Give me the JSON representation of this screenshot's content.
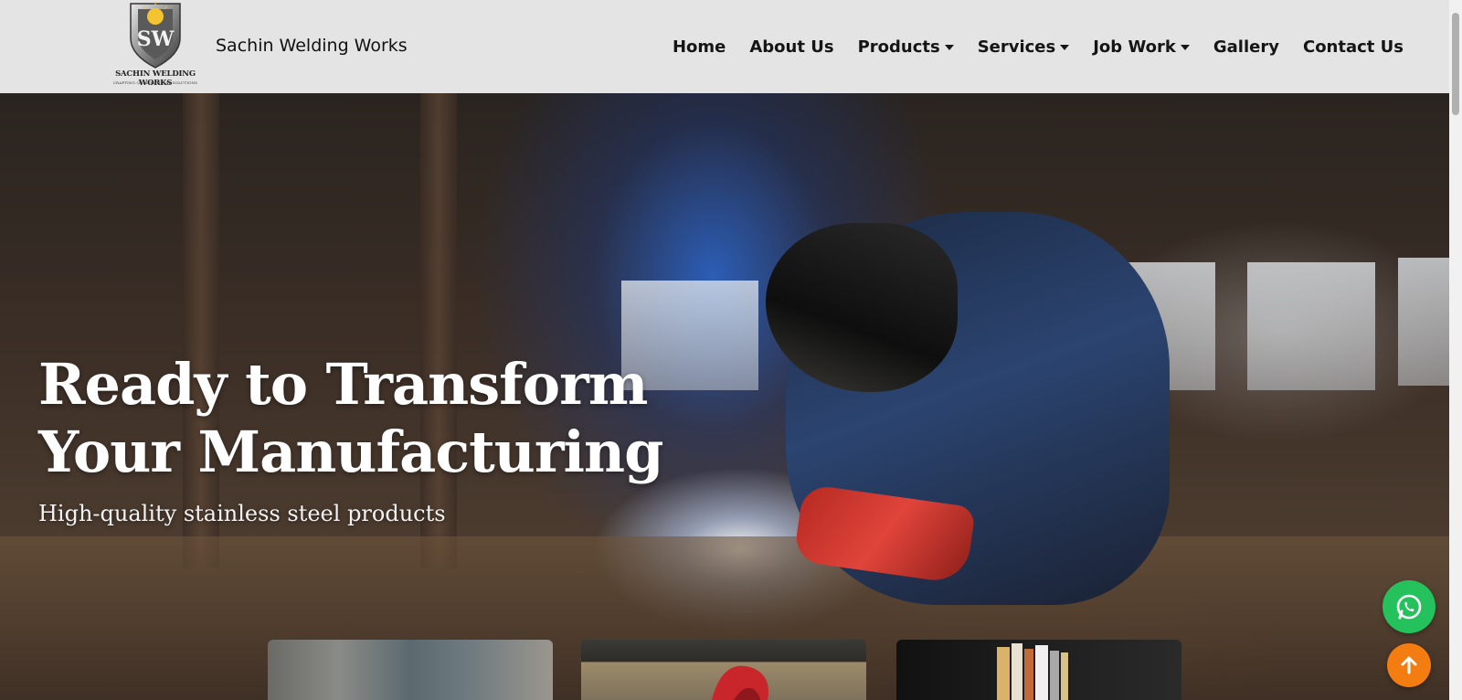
{
  "header": {
    "logo": {
      "icon": "shield-sw-logo-icon",
      "name_line": "SACHIN WELDING WORKS",
      "tagline": "CRAFTING QUALITY METAL SOLUTIONS"
    },
    "brand_name": "Sachin Welding Works",
    "nav": [
      {
        "label": "Home",
        "has_dropdown": false
      },
      {
        "label": "About Us",
        "has_dropdown": false
      },
      {
        "label": "Products",
        "has_dropdown": true
      },
      {
        "label": "Services",
        "has_dropdown": true
      },
      {
        "label": "Job Work",
        "has_dropdown": true
      },
      {
        "label": "Gallery",
        "has_dropdown": false
      },
      {
        "label": "Contact Us",
        "has_dropdown": false
      }
    ]
  },
  "hero": {
    "title": "Ready to Transform Your Manufacturing",
    "subtitle": "High-quality stainless steel products",
    "background": "welder-at-work-image"
  },
  "cards": [
    {
      "image": "building-facade-image"
    },
    {
      "image": "red-steel-sculpture-image"
    },
    {
      "image": "steel-profiles-image"
    }
  ],
  "floating": {
    "whatsapp_icon": "whatsapp-icon",
    "whatsapp_color": "#25c15c",
    "back_to_top_icon": "arrow-up-icon",
    "back_to_top_color": "#f47d12"
  }
}
